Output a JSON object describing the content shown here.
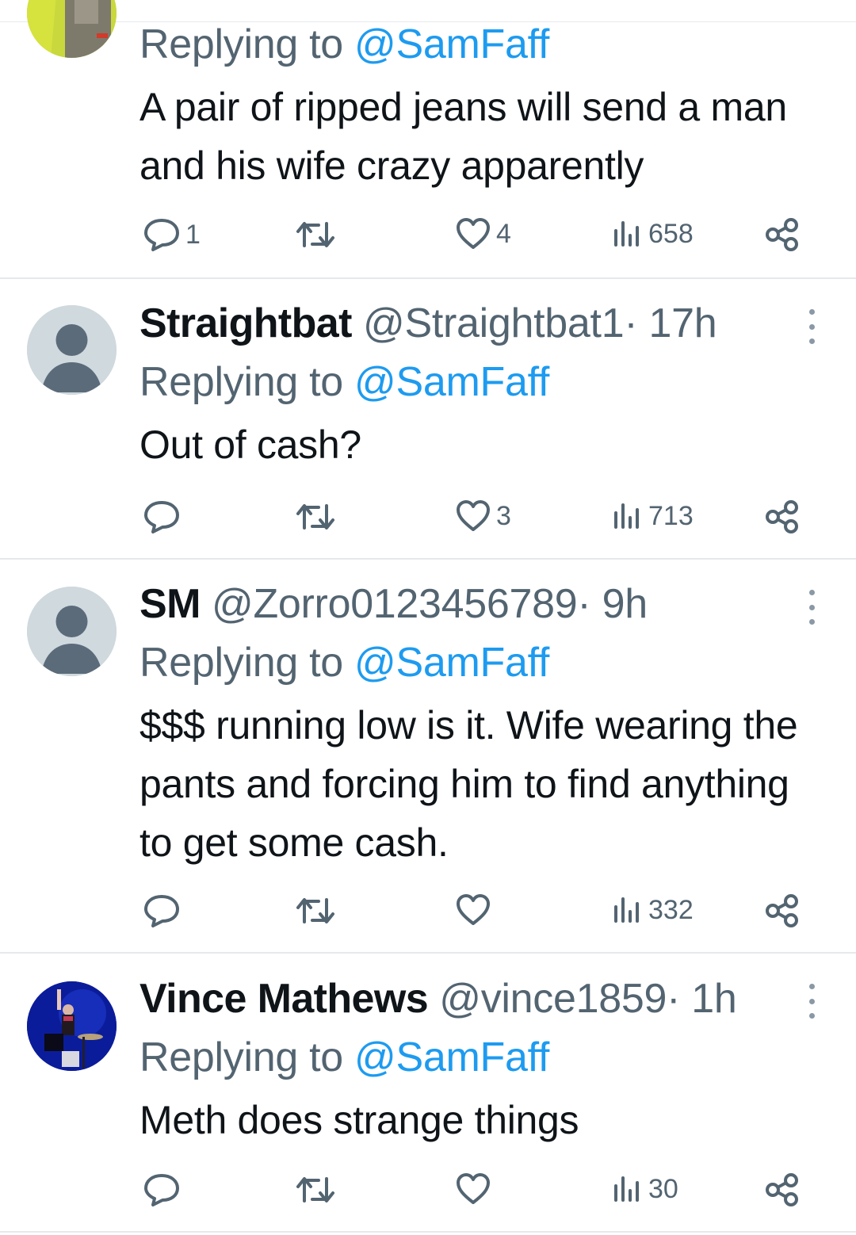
{
  "thread": {
    "reply_prefix": "Replying to",
    "tweets": [
      {
        "name": "",
        "handle": "",
        "time": "",
        "replying_to": "@SamFaff",
        "text": "A pair of ripped jeans will send a man and his wife crazy apparently",
        "replies": "1",
        "retweets": "",
        "likes": "4",
        "views": "658"
      },
      {
        "name": "Straightbat",
        "handle": "@Straightbat1",
        "time": "· 17h",
        "replying_to": "@SamFaff",
        "text": "Out of cash?",
        "replies": "",
        "retweets": "",
        "likes": "3",
        "views": "713"
      },
      {
        "name": "SM",
        "handle": "@Zorro0123456789",
        "time": "· 9h",
        "replying_to": "@SamFaff",
        "text": "$$$ running low is it. Wife wearing the pants and forcing him to find anything to get some cash.",
        "replies": "",
        "retweets": "",
        "likes": "",
        "views": "332"
      },
      {
        "name": "Vince Mathews",
        "handle": "@vince1859",
        "time": "· 1h",
        "replying_to": "@SamFaff",
        "text": "Meth does strange things",
        "replies": "",
        "retweets": "",
        "likes": "",
        "views": "30"
      }
    ]
  },
  "icons": {
    "reply": "reply-bubble-icon",
    "retweet": "retweet-icon",
    "like": "heart-icon",
    "views": "views-bar-chart-icon",
    "share": "share-icon",
    "more": "more-vertical-icon"
  },
  "colors": {
    "link": "#1d9bf0",
    "muted": "#536471",
    "text": "#0f1419",
    "divider": "#e6e9ec"
  }
}
